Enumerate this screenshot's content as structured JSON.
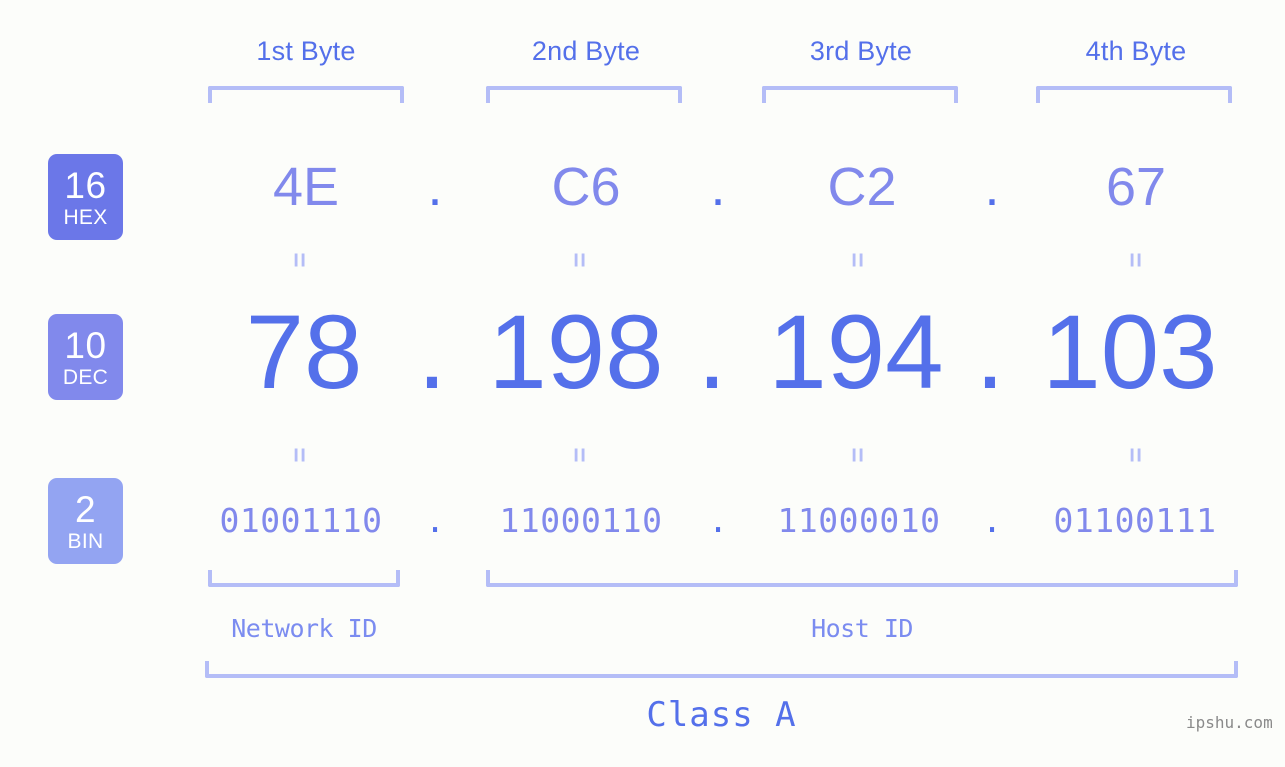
{
  "background_color": "#fcfdfa",
  "colors": {
    "accent_strong": "#5470ea",
    "accent_mid": "#8189ec",
    "accent_light": "#b4bdf7",
    "badge_hex": "#6b77e8",
    "badge_dec": "#8189ec",
    "badge_bin": "#93a4f2",
    "watermark": "#8a8a8a"
  },
  "byte_headers": [
    {
      "label": "1st Byte"
    },
    {
      "label": "2nd Byte"
    },
    {
      "label": "3rd Byte"
    },
    {
      "label": "4th Byte"
    }
  ],
  "badges": [
    {
      "base": "16",
      "name": "HEX"
    },
    {
      "base": "10",
      "name": "DEC"
    },
    {
      "base": "2",
      "name": "BIN"
    }
  ],
  "rows": {
    "hex": {
      "values": [
        "4E",
        "C6",
        "C2",
        "67"
      ],
      "separator": "."
    },
    "dec": {
      "values": [
        "78",
        "198",
        "194",
        "103"
      ],
      "separator": "."
    },
    "bin": {
      "values": [
        "01001110",
        "11000110",
        "11000010",
        "01100111"
      ],
      "separator": "."
    }
  },
  "equals_glyph": "=",
  "sections": [
    {
      "label": "Network ID"
    },
    {
      "label": "Host ID"
    }
  ],
  "class_label": "Class A",
  "watermark": "ipshu.com"
}
